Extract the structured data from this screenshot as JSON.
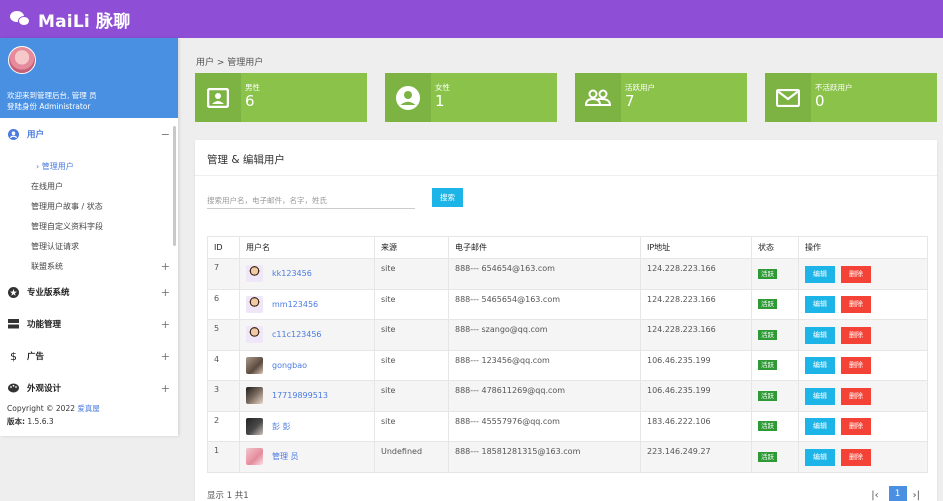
{
  "app": {
    "brand": "MaiLi 脉聊"
  },
  "sidebar": {
    "welcome_line1": "欢迎来到管理后台, 管理 员",
    "welcome_line2": "登陆身份 Administrator",
    "groups": {
      "users": "用户",
      "pro": "专业版系统",
      "features": "功能管理",
      "ads": "广告",
      "appearance": "外观设计"
    },
    "users_items": [
      "› 管理用户",
      "在线用户",
      "管理用户故事 / 状态",
      "管理自定义资料字段",
      "管理认证请求",
      "联盟系统"
    ],
    "copyright_prefix": "Copyright © 2022 ",
    "copyright_link": "爱真屋",
    "version_label": "版本:",
    "version": " 1.5.6.3"
  },
  "breadcrumb": "用户 > 管理用户",
  "stats": [
    {
      "label": "男性",
      "value": "6"
    },
    {
      "label": "女性",
      "value": "1"
    },
    {
      "label": "活跃用户",
      "value": "7"
    },
    {
      "label": "不活跃用户",
      "value": "0"
    }
  ],
  "panel": {
    "title": "管理 & 编辑用户",
    "search_placeholder": "搜索用户名，电子邮件，名字，姓氏",
    "search_button": "搜索"
  },
  "table": {
    "headers": [
      "ID",
      "用户名",
      "来源",
      "电子邮件",
      "IP地址",
      "状态",
      "操作"
    ],
    "rows": [
      {
        "id": "7",
        "username": "kk123456",
        "source": "site",
        "email": "888--- 654654@163.com",
        "ip": "124.228.223.166",
        "status": "活跃"
      },
      {
        "id": "6",
        "username": "mm123456",
        "source": "site",
        "email": "888--- 5465654@163.com",
        "ip": "124.228.223.166",
        "status": "活跃"
      },
      {
        "id": "5",
        "username": "c11c123456",
        "source": "site",
        "email": "888--- szango@qq.com",
        "ip": "124.228.223.166",
        "status": "活跃"
      },
      {
        "id": "4",
        "username": "gongbao",
        "source": "site",
        "email": "888--- 123456@qq.com",
        "ip": "106.46.235.199",
        "status": "活跃"
      },
      {
        "id": "3",
        "username": "17719899513",
        "source": "site",
        "email": "888--- 478611269@qq.com",
        "ip": "106.46.235.199",
        "status": "活跃"
      },
      {
        "id": "2",
        "username": "彭 彭",
        "source": "site",
        "email": "888--- 45557976@qq.com",
        "ip": "183.46.222.106",
        "status": "活跃"
      },
      {
        "id": "1",
        "username": "管理 员",
        "source": "Undefined",
        "email": "888--- 18581281315@163.com",
        "ip": "223.146.249.27",
        "status": "活跃"
      }
    ],
    "edit_label": "编辑",
    "delete_label": "删除"
  },
  "footer": {
    "showing": "显示 1 共1",
    "first": "|‹",
    "current_page": "1",
    "last": "›|"
  }
}
